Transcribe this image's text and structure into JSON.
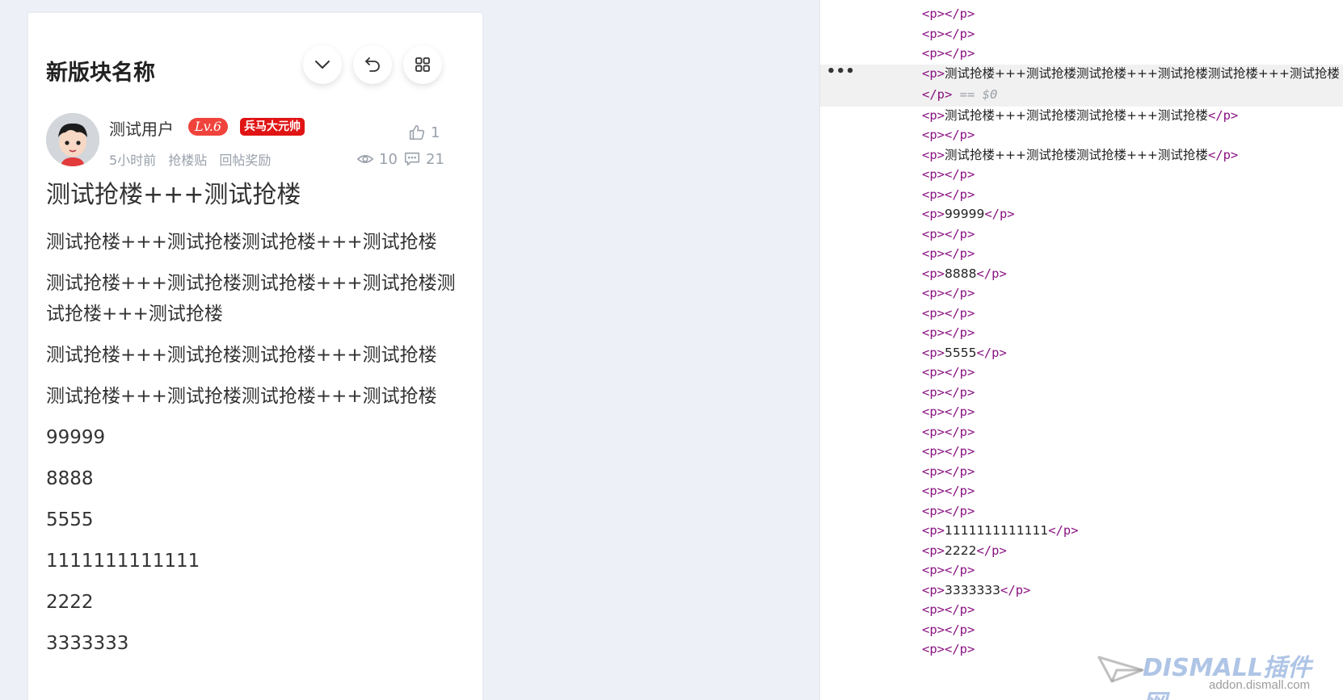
{
  "card": {
    "title": "新版块名称",
    "author": {
      "name": "测试用户",
      "level": "Lv.6",
      "rank_title": "兵马大元帅"
    },
    "meta": {
      "time": "5小时前",
      "tag1": "抢楼贴",
      "tag2": "回帖奖励"
    },
    "stats": {
      "likes": "1",
      "views": "10",
      "comments": "21"
    },
    "content": {
      "lead": "测试抢楼+++测试抢楼",
      "paragraphs": [
        "测试抢楼+++测试抢楼测试抢楼+++测试抢楼",
        "测试抢楼+++测试抢楼测试抢楼+++测试抢楼测试抢楼+++测试抢楼",
        "测试抢楼+++测试抢楼测试抢楼+++测试抢楼",
        "测试抢楼+++测试抢楼测试抢楼+++测试抢楼",
        "99999",
        "8888",
        "5555",
        "1111111111111",
        "2222",
        "3333333"
      ]
    }
  },
  "devtools": {
    "open_tag": "<p>",
    "close_tag": "</p>",
    "selected_marker": "== $0",
    "dots": "•••",
    "lines": [
      "",
      "",
      "",
      "测试抢楼+++测试抢楼测试抢楼+++测试抢楼测试抢楼+++测试抢楼",
      "测试抢楼+++测试抢楼测试抢楼+++测试抢楼",
      "",
      "测试抢楼+++测试抢楼测试抢楼+++测试抢楼",
      "",
      "",
      "99999",
      "",
      "",
      "8888",
      "",
      "",
      "",
      "5555",
      "",
      "",
      "",
      "",
      "",
      "",
      "",
      "",
      "1111111111111",
      "2222",
      "",
      "3333333",
      "",
      "",
      ""
    ]
  },
  "watermark": {
    "brand": "DISMALL插件网",
    "url": "addon.dismall.com"
  },
  "colors": {
    "page_bg": "#edf0f7",
    "card_bg": "#ffffff",
    "level_badge": "#f0433c",
    "rank_badge": "#e01414",
    "tag_color": "#881280",
    "muted_text": "#9aa1ab"
  },
  "icons": {
    "collapse": "chevron-down-icon",
    "back": "undo-arrow-icon",
    "grid": "grid-icon",
    "like": "thumbs-up-icon",
    "views": "eye-icon",
    "comments": "comment-icon"
  }
}
